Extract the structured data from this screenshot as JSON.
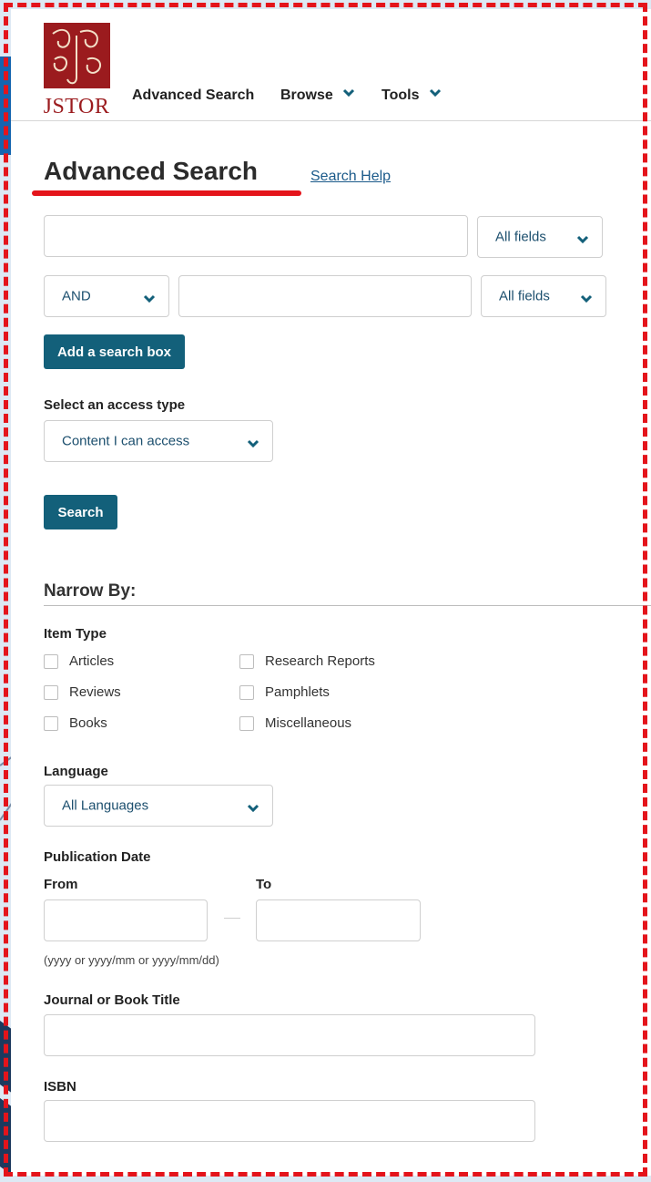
{
  "logo": {
    "text": "JSTOR"
  },
  "nav": {
    "items": [
      {
        "label": "Advanced Search",
        "has_dropdown": false
      },
      {
        "label": "Browse",
        "has_dropdown": true
      },
      {
        "label": "Tools",
        "has_dropdown": true
      }
    ]
  },
  "page": {
    "title": "Advanced Search",
    "help_link": "Search Help"
  },
  "search": {
    "row1": {
      "query": "",
      "field": "All fields"
    },
    "row2": {
      "operator": "AND",
      "query": "",
      "field": "All fields"
    },
    "add_box_label": "Add a search box",
    "access_label": "Select an access type",
    "access_value": "Content I can access",
    "search_button": "Search"
  },
  "narrow": {
    "title": "Narrow By:",
    "item_type_label": "Item Type",
    "item_types": [
      {
        "label": "Articles",
        "checked": false
      },
      {
        "label": "Research Reports",
        "checked": false
      },
      {
        "label": "Reviews",
        "checked": false
      },
      {
        "label": "Pamphlets",
        "checked": false
      },
      {
        "label": "Books",
        "checked": false
      },
      {
        "label": "Miscellaneous",
        "checked": false
      }
    ],
    "language_label": "Language",
    "language_value": "All Languages",
    "pub_date_label": "Publication Date",
    "from_label": "From",
    "to_label": "To",
    "from_value": "",
    "to_value": "",
    "date_hint": "(yyyy or yyyy/mm or yyyy/mm/dd)",
    "journal_label": "Journal or Book Title",
    "journal_value": "",
    "isbn_label": "ISBN",
    "isbn_value": ""
  },
  "colors": {
    "brand": "#9b1b1e",
    "button": "#13607a",
    "link": "#1b5a8a",
    "highlight": "#e4141b"
  },
  "icons": [
    "chevron-down-icon",
    "jstor-logo"
  ]
}
